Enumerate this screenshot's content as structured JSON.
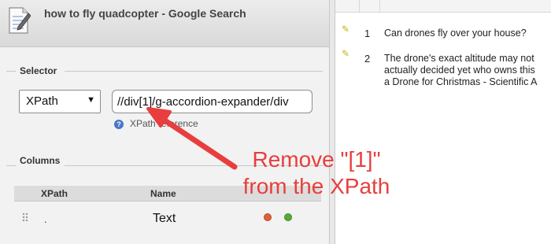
{
  "window": {
    "title": "how to fly quadcopter - Google Search",
    "icon": "document-pencil-icon"
  },
  "selector": {
    "section_label": "Selector",
    "type_value": "XPath",
    "type_arrow": "▼",
    "xpath_value": "//div[1]/g-accordion-expander/div",
    "help_icon": "?",
    "help_link": "XPath reference"
  },
  "columns": {
    "section_label": "Columns",
    "headers": {
      "xpath": "XPath",
      "name": "Name"
    },
    "rows": [
      {
        "xpath": ".",
        "name": "Text"
      }
    ]
  },
  "results": {
    "rows": [
      {
        "num": "1",
        "text": [
          "Can drones fly over your house?"
        ]
      },
      {
        "num": "2",
        "text": [
          "The drone's exact altitude may not",
          "actually decided yet who owns this",
          "a Drone for Christmas - Scientific A"
        ]
      }
    ]
  },
  "annotation": {
    "lines": [
      "Remove \"[1]\"",
      "from the XPath"
    ],
    "color": "#e83e3e"
  },
  "colors": {
    "accent_remove": "#e2603c",
    "accent_add": "#5aa83a",
    "pencil": "#c9b800"
  }
}
